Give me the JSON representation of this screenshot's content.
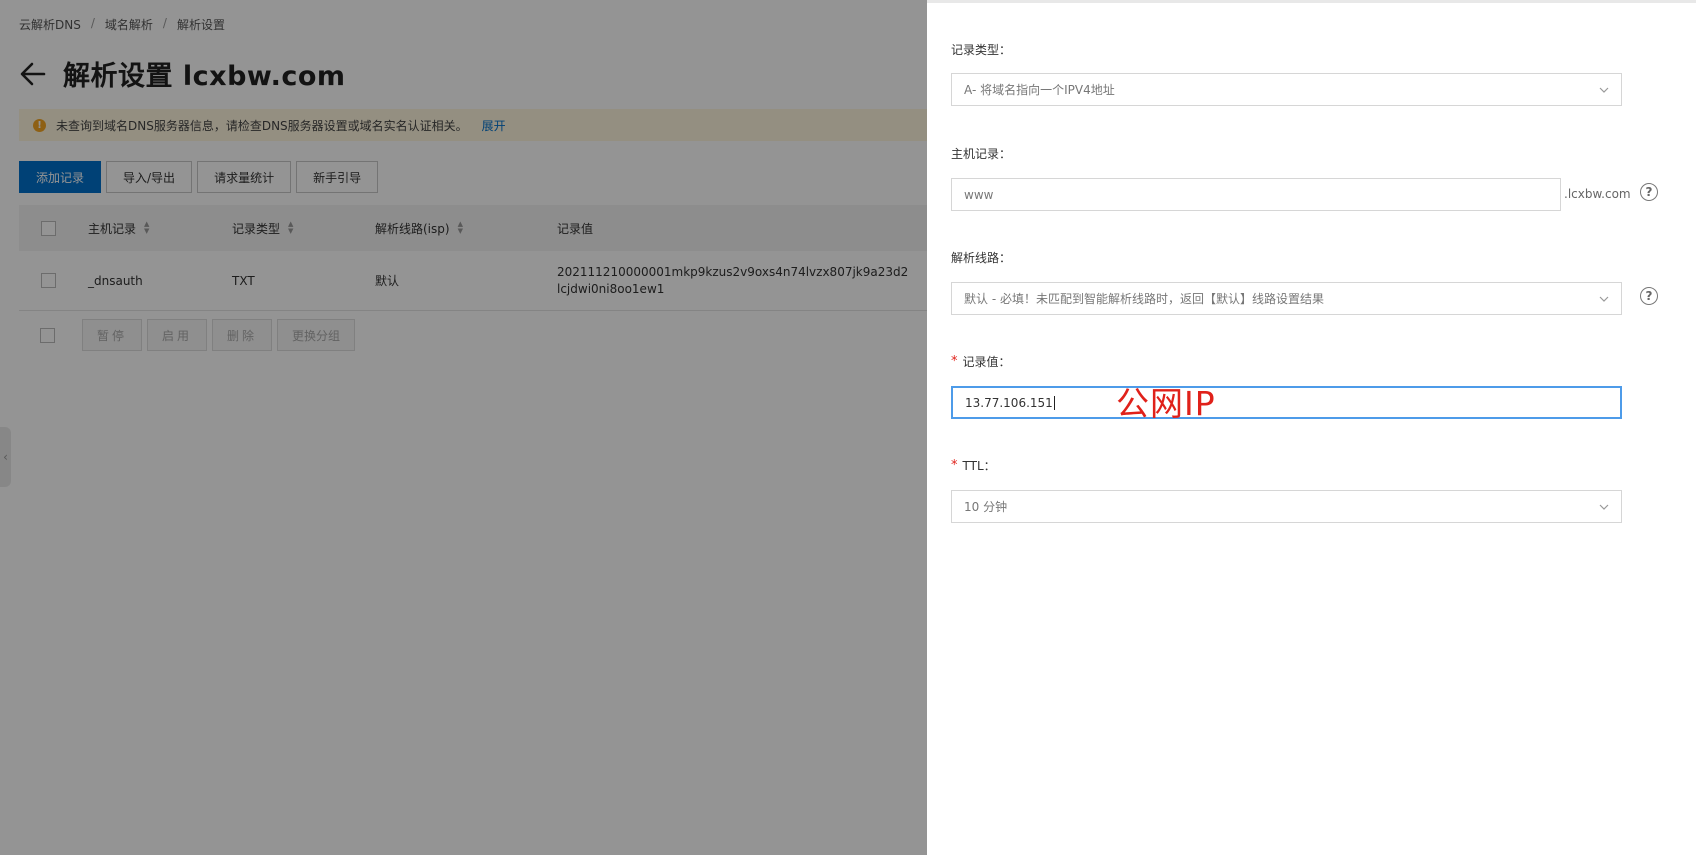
{
  "breadcrumb": [
    "云解析DNS",
    "域名解析",
    "解析设置"
  ],
  "breadcrumb_sep": "/",
  "page_title": "解析设置 lcxbw.com",
  "notice": {
    "text": "未查询到域名DNS服务器信息，请检查DNS服务器设置或域名实名认证相关。",
    "link": "展开"
  },
  "toolbar": {
    "add": "添加记录",
    "import_export": "导入/导出",
    "stats": "请求量统计",
    "guide": "新手引导"
  },
  "table": {
    "headers": [
      "主机记录",
      "记录类型",
      "解析线路(isp)",
      "记录值"
    ],
    "rows": [
      {
        "host": "_dnsauth",
        "type": "TXT",
        "line": "默认",
        "value_line1": "202111210000001mkp9kzus2v9oxs4n74lvzx807jk9a23d2",
        "value_line2": "lcjdwi0ni8oo1ew1"
      }
    ]
  },
  "batch": {
    "pause": "暂停",
    "enable": "启用",
    "delete": "删除",
    "group": "更换分组"
  },
  "form": {
    "record_type_label": "记录类型：",
    "record_type_value": "A- 将域名指向一个IPV4地址",
    "host_label": "主机记录：",
    "host_value": "www",
    "host_suffix": ".lcxbw.com",
    "line_label": "解析线路：",
    "line_value": "默认 - 必填！未匹配到智能解析线路时，返回【默认】线路设置结果",
    "value_label": "记录值：",
    "value_value": "13.77.106.151",
    "ttl_label": "TTL：",
    "ttl_value": "10 分钟",
    "required_mark": "*",
    "help_mark": "?"
  },
  "annotation": "公网IP",
  "colors": {
    "primary": "#0070cc",
    "required": "#e0211a",
    "focus_border": "#4d9be9",
    "notice_bg": "#fff7df",
    "warning": "#f5a623"
  }
}
